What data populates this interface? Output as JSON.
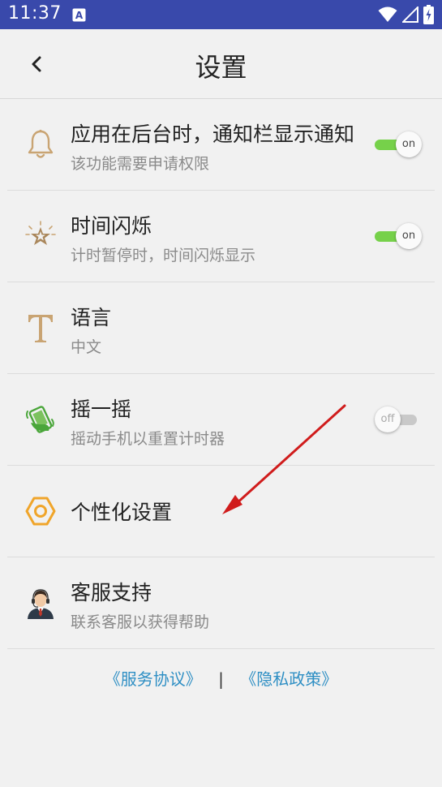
{
  "status_bar": {
    "time": "11:37",
    "sim_icon": "A"
  },
  "header": {
    "title": "设置",
    "back_icon": "chevron-left-icon"
  },
  "settings": {
    "notification": {
      "label": "应用在后台时，通知栏显示通知",
      "sub": "该功能需要申请权限",
      "toggle": "on",
      "icon": "bell-icon"
    },
    "time_flash": {
      "label": "时间闪烁",
      "sub": "计时暂停时，时间闪烁显示",
      "toggle": "on",
      "icon": "star-icon"
    },
    "language": {
      "label": "语言",
      "sub": "中文",
      "icon": "font-t-icon"
    },
    "shake": {
      "label": "摇一摇",
      "sub": "摇动手机以重置计时器",
      "toggle": "off",
      "icon": "shake-phone-icon"
    },
    "personalize": {
      "label": "个性化设置",
      "icon": "hexagon-nut-icon"
    },
    "support": {
      "label": "客服支持",
      "sub": "联系客服以获得帮助",
      "icon": "support-agent-icon"
    }
  },
  "footer": {
    "service_agreement": "《服务协议》",
    "separator": "|",
    "privacy_policy": "《隐私政策》"
  },
  "colors": {
    "status_bar": "#3949ab",
    "toggle_on": "#76d14a",
    "link": "#2f8fc4",
    "annotation_arrow": "#d01c1c",
    "icon_gold": "#c9a473"
  }
}
